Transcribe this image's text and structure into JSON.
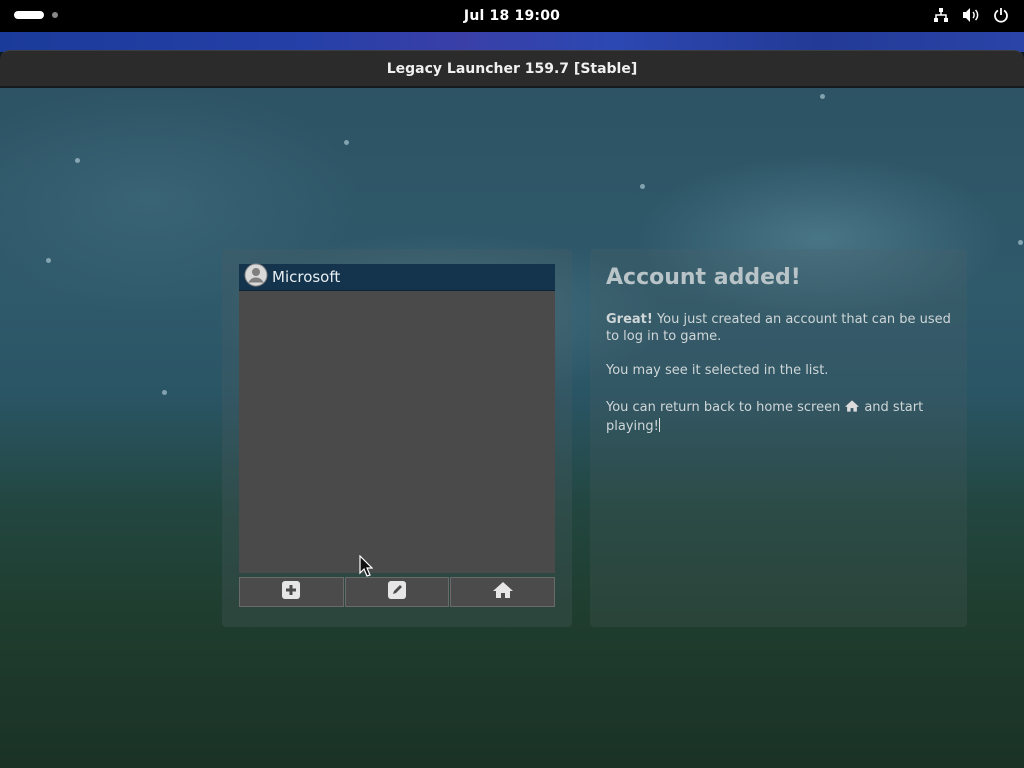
{
  "topbar": {
    "clock": "Jul 18  19:00"
  },
  "window": {
    "title": "Legacy Launcher 159.7 [Stable]"
  },
  "accounts": {
    "items": [
      {
        "label": "Microsoft",
        "icon": "user-circle-icon",
        "selected": true
      }
    ],
    "actions": [
      {
        "name": "add-account-button",
        "icon": "plus-square-icon"
      },
      {
        "name": "edit-account-button",
        "icon": "pencil-icon"
      },
      {
        "name": "home-button",
        "icon": "home-icon"
      }
    ]
  },
  "info": {
    "title": "Account added!",
    "p1_strong": "Great!",
    "p1_rest": " You just created an account that can be used to log in to game.",
    "p2": "You may see it selected in the list.",
    "p3_before": "You can return back to home screen",
    "p3_after": "and start playing!"
  },
  "colors": {
    "selected_row": "#14344d",
    "list_bg": "#4a4a4a",
    "titlebar": "#2b2b2b"
  }
}
